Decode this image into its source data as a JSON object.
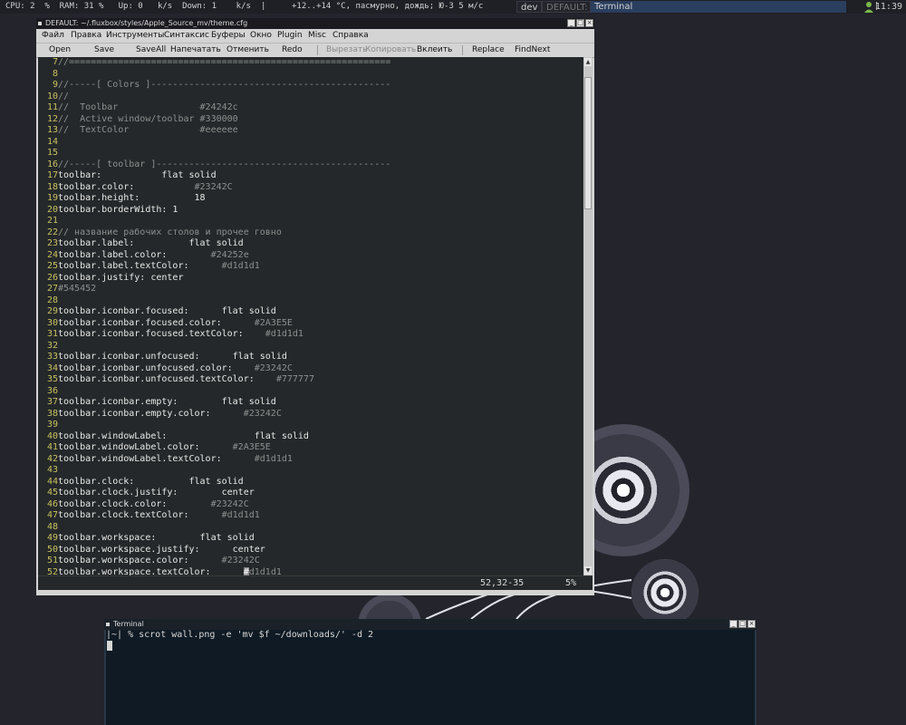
{
  "panel": {
    "stats": "CPU: 2  %  RAM: 31 %   Up: 0   k/s  Down: 1    k/s",
    "separator": "|",
    "weather": "+12..+14 °C, пасмурно, дождь; Ю-З 5 м/с",
    "workspaces": [
      {
        "label": "dev"
      },
      {
        "label": "DEFAULT:"
      },
      {
        "label": "Terminal"
      }
    ],
    "clock": "11:39"
  },
  "editor_window": {
    "title": "DEFAULT: ~/.fluxbox/styles/Apple_Source_mv/theme.cfg",
    "menu": [
      "Файл",
      "Правка",
      "Инструменты",
      "Синтаксис",
      "Буферы",
      "Окно",
      "Plugin",
      "Misc",
      "Справка"
    ],
    "toolbar": {
      "open": "Open",
      "save": "Save",
      "saveall": "SaveAll",
      "print": "Напечатать",
      "undo": "Отменить",
      "redo": "Redo",
      "cut": "Вырезать",
      "copy": "Копировать",
      "paste": "Вклеить",
      "replace": "Replace",
      "findnext": "FindNext"
    },
    "lines": [
      {
        "n": "7",
        "t": "//===========================================================",
        "k": "cmt"
      },
      {
        "n": "8",
        "t": "",
        "k": "code"
      },
      {
        "n": "9",
        "t": "//-----[ Colors ]--------------------------------------------",
        "k": "cmt"
      },
      {
        "n": "10",
        "t": "//",
        "k": "cmt"
      },
      {
        "n": "11",
        "t": "//  Toolbar               #24242c",
        "k": "cmt"
      },
      {
        "n": "12",
        "t": "//  Active window/toolbar #330000",
        "k": "cmt"
      },
      {
        "n": "13",
        "t": "//  TextColor             #eeeeee",
        "k": "cmt"
      },
      {
        "n": "14",
        "t": "",
        "k": "code"
      },
      {
        "n": "15",
        "t": "",
        "k": "code"
      },
      {
        "n": "16",
        "t": "//-----[ toolbar ]-------------------------------------------",
        "k": "cmt"
      },
      {
        "n": "17",
        "t": "toolbar:           flat solid",
        "k": "code"
      },
      {
        "n": "18",
        "t": "toolbar.color:           ",
        "c": "#23242C",
        "k": "code"
      },
      {
        "n": "19",
        "t": "toolbar.height:          18",
        "k": "code"
      },
      {
        "n": "20",
        "t": "toolbar.borderWidth: 1",
        "k": "code"
      },
      {
        "n": "21",
        "t": "",
        "k": "code"
      },
      {
        "n": "22",
        "t": "// название рабочих столов и прочее говно",
        "k": "cmt"
      },
      {
        "n": "23",
        "t": "toolbar.label:          flat solid",
        "k": "code"
      },
      {
        "n": "24",
        "t": "toolbar.label.color:        ",
        "c": "#24252e",
        "k": "code"
      },
      {
        "n": "25",
        "t": "toolbar.label.textColor:      ",
        "c": "#d1d1d1",
        "k": "code"
      },
      {
        "n": "26",
        "t": "toolbar.justify: center",
        "k": "code"
      },
      {
        "n": "27",
        "t": "",
        "c": "#545452",
        "k": "code"
      },
      {
        "n": "28",
        "t": "",
        "k": "code"
      },
      {
        "n": "29",
        "t": "toolbar.iconbar.focused:      flat solid",
        "k": "code"
      },
      {
        "n": "30",
        "t": "toolbar.iconbar.focused.color:      ",
        "c": "#2A3E5E",
        "k": "code"
      },
      {
        "n": "31",
        "t": "toolbar.iconbar.focused.textColor:    ",
        "c": "#d1d1d1",
        "k": "code"
      },
      {
        "n": "32",
        "t": "",
        "k": "code"
      },
      {
        "n": "33",
        "t": "toolbar.iconbar.unfocused:      flat solid",
        "k": "code"
      },
      {
        "n": "34",
        "t": "toolbar.iconbar.unfocused.color:    ",
        "c": "#23242C",
        "k": "code"
      },
      {
        "n": "35",
        "t": "toolbar.iconbar.unfocused.textColor:    ",
        "c": "#777777",
        "k": "code"
      },
      {
        "n": "36",
        "t": "",
        "k": "code"
      },
      {
        "n": "37",
        "t": "toolbar.iconbar.empty:        flat solid",
        "k": "code"
      },
      {
        "n": "38",
        "t": "toolbar.iconbar.empty.color:      ",
        "c": "#23242C",
        "k": "code"
      },
      {
        "n": "39",
        "t": "",
        "k": "code"
      },
      {
        "n": "40",
        "t": "toolbar.windowLabel:                flat solid",
        "k": "code"
      },
      {
        "n": "41",
        "t": "toolbar.windowLabel.color:      ",
        "c": "#2A3E5E",
        "k": "code"
      },
      {
        "n": "42",
        "t": "toolbar.windowLabel.textColor:      ",
        "c": "#d1d1d1",
        "k": "code"
      },
      {
        "n": "43",
        "t": "",
        "k": "code"
      },
      {
        "n": "44",
        "t": "toolbar.clock:          flat solid",
        "k": "code"
      },
      {
        "n": "45",
        "t": "toolbar.clock.justify:        center",
        "k": "code"
      },
      {
        "n": "46",
        "t": "toolbar.clock.color:        ",
        "c": "#23242C",
        "k": "code"
      },
      {
        "n": "47",
        "t": "toolbar.clock.textColor:      ",
        "c": "#d1d1d1",
        "k": "code"
      },
      {
        "n": "48",
        "t": "",
        "k": "code"
      },
      {
        "n": "49",
        "t": "toolbar.workspace:        flat solid",
        "k": "code"
      },
      {
        "n": "50",
        "t": "toolbar.workspace.justify:      center",
        "k": "code"
      },
      {
        "n": "51",
        "t": "toolbar.workspace.color:      ",
        "c": "#23242C",
        "k": "code"
      },
      {
        "n": "52",
        "t": "toolbar.workspace.textColor:      ",
        "c": "#d1d1d1",
        "k": "code",
        "cursor": true
      }
    ],
    "status_position": "52,32-35",
    "status_percent": "5%",
    "scroll_fraction": 0.05
  },
  "terminal_window": {
    "title": "Terminal",
    "command_line": "|~| % scrot wall.png -e 'mv $f ~/downloads/' -d 2"
  },
  "colors": {
    "desktop": "#24242c",
    "editor_bg": "#24282a",
    "line_number": "#c8c060",
    "terminal_bg": "#0f1a24",
    "active_workspace": "#2a3e5e"
  }
}
